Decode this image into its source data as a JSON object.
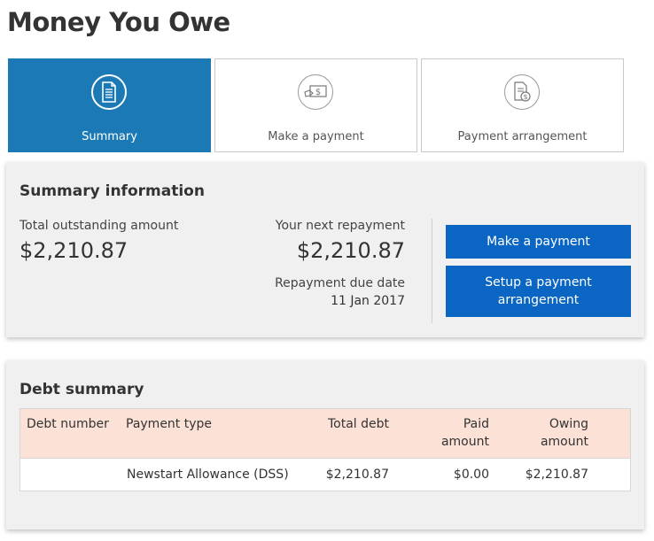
{
  "page": {
    "title": "Money You Owe"
  },
  "tabs": [
    {
      "label": "Summary",
      "icon": "document-icon",
      "active": true
    },
    {
      "label": "Make a payment",
      "icon": "payment-card-icon",
      "active": false
    },
    {
      "label": "Payment arrangement",
      "icon": "document-dollar-icon",
      "active": false
    }
  ],
  "summary": {
    "title": "Summary information",
    "total_label": "Total outstanding amount",
    "total_amount": "$2,210.87",
    "next_label": "Your next repayment",
    "next_amount": "$2,210.87",
    "due_label": "Repayment due date",
    "due_date": "11 Jan 2017",
    "make_payment_label": "Make a payment",
    "setup_arrangement_label": "Setup a payment arrangement"
  },
  "debt": {
    "title": "Debt summary",
    "headers": {
      "debt_number": "Debt number",
      "payment_type": "Payment type",
      "total_debt": "Total debt",
      "paid_amount_1": "Paid",
      "paid_amount_2": "amount",
      "owing_amount_1": "Owing",
      "owing_amount_2": "amount"
    },
    "rows": [
      {
        "debt_number": "",
        "payment_type": "Newstart Allowance (DSS)",
        "total_debt": "$2,210.87",
        "paid_amount": "$0.00",
        "owing_amount": "$2,210.87"
      }
    ]
  },
  "colors": {
    "brand_blue": "#1b7ab5",
    "button_blue": "#0b66c3",
    "table_header_bg": "#fce1d6",
    "panel_bg": "#f0f0f0"
  }
}
